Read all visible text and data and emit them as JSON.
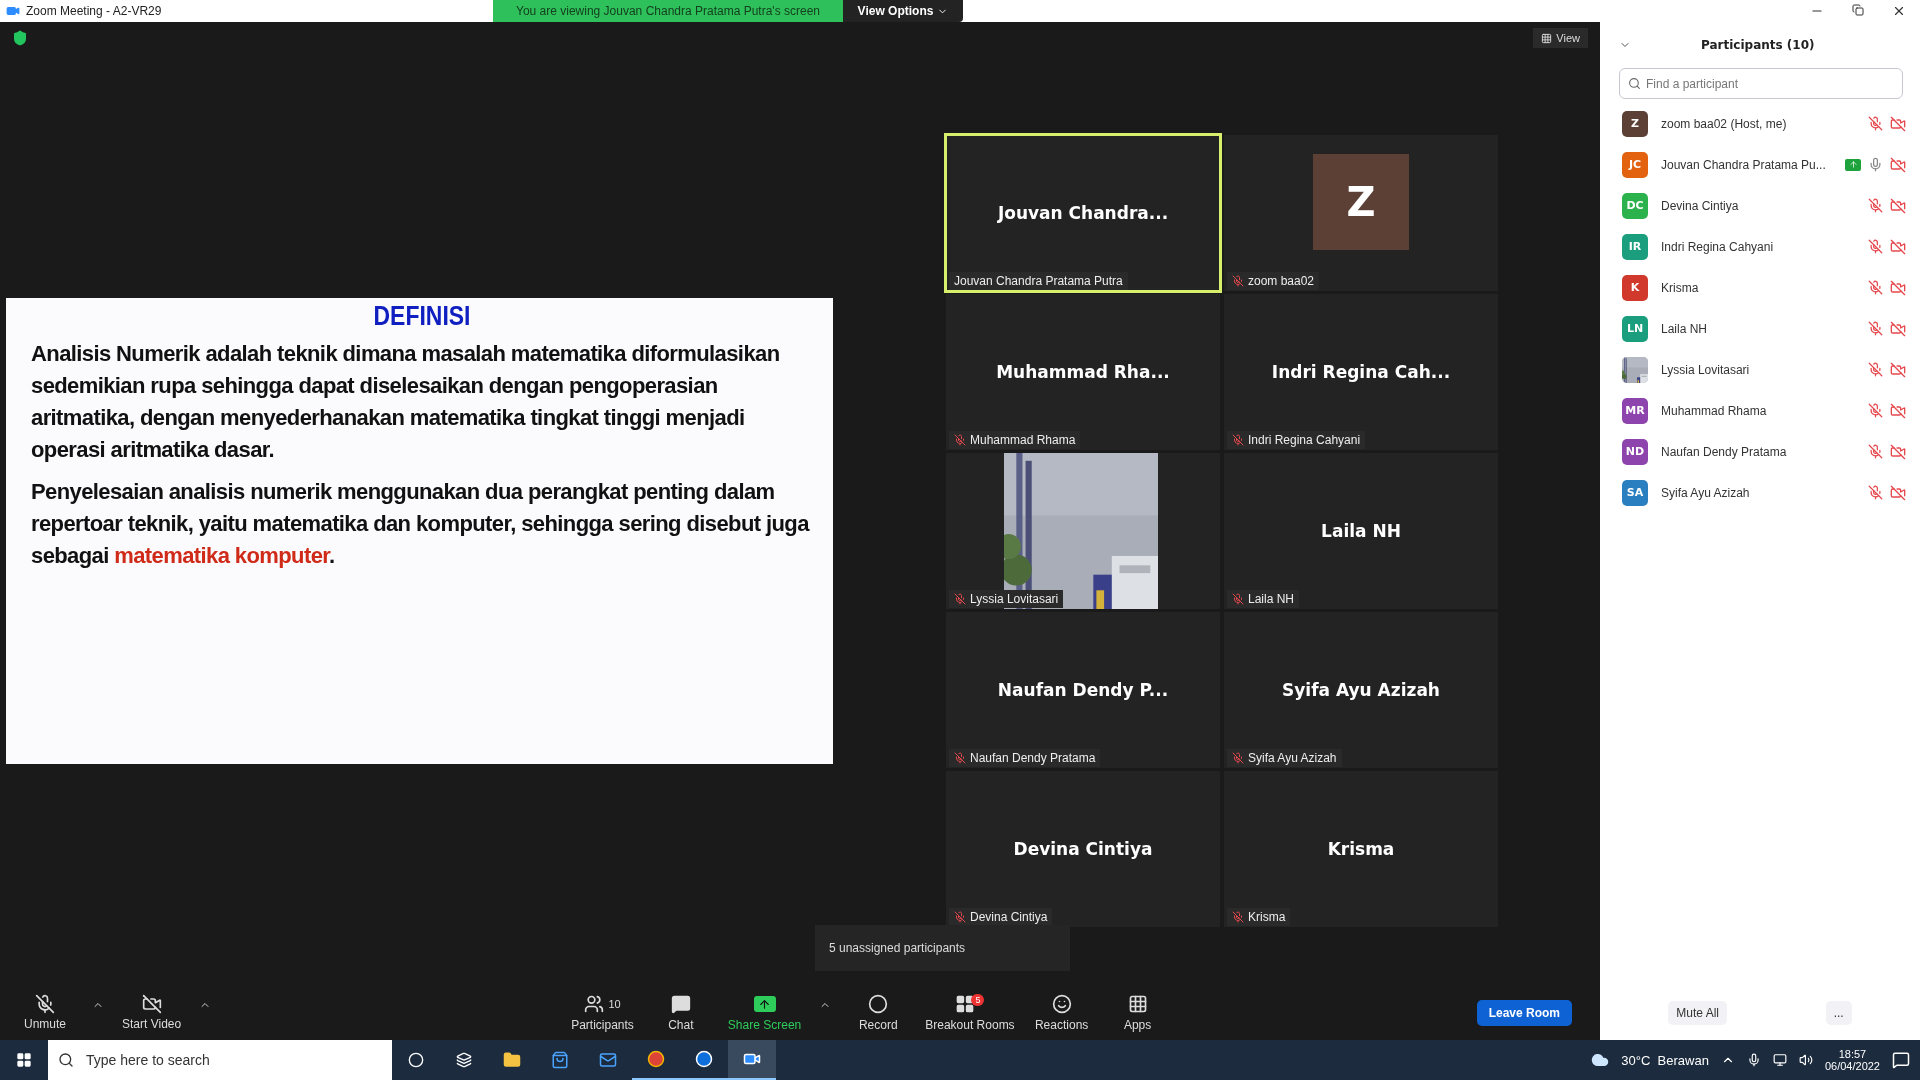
{
  "window": {
    "title": "Zoom Meeting - A2-VR29"
  },
  "share_banner": {
    "text": "You are viewing Jouvan Chandra Pratama Putra's screen",
    "button": "View Options"
  },
  "view_button": "View",
  "slide": {
    "title": "DEFINISI",
    "paragraphs": [
      {
        "text": "Analisis Numerik adalah teknik dimana masalah matematika diformulasikan sedemikian rupa sehingga dapat diselesaikan dengan pengoperasian aritmatika, dengan menyederhanakan matematika tingkat tinggi menjadi operasi aritmatika dasar."
      },
      {
        "text": "Penyelesaian analisis numerik menggunakan dua perangkat penting dalam repertoar teknik, yaitu matematika dan komputer, sehingga sering disebut juga sebagai ",
        "highlight": "matematika komputer",
        "after": "."
      }
    ]
  },
  "tiles": [
    {
      "kind": "name",
      "title": "Jouvan Chandra...",
      "label": "Jouvan Chandra Pratama Putra",
      "muted": false,
      "active": true
    },
    {
      "kind": "avatar",
      "title": "Z",
      "label": "zoom baa02",
      "muted": true,
      "active": false,
      "color": "#5c4036"
    },
    {
      "kind": "name",
      "title": "Muhammad Rha...",
      "label": "Muhammad Rhama",
      "muted": true,
      "active": false
    },
    {
      "kind": "name",
      "title": "Indri Regina Cah...",
      "label": "Indri Regina Cahyani",
      "muted": true,
      "active": false
    },
    {
      "kind": "picture",
      "label": "Lyssia Lovitasari",
      "muted": true,
      "active": false
    },
    {
      "kind": "name",
      "title": "Laila NH",
      "label": "Laila NH",
      "muted": true,
      "active": false
    },
    {
      "kind": "name",
      "title": "Naufan Dendy P...",
      "label": "Naufan Dendy Pratama",
      "muted": true,
      "active": false
    },
    {
      "kind": "name",
      "title": "Syifa Ayu Azizah",
      "label": "Syifa Ayu Azizah",
      "muted": true,
      "active": false
    },
    {
      "kind": "name",
      "title": "Devina Cintiya",
      "label": "Devina Cintiya",
      "muted": true,
      "active": false
    },
    {
      "kind": "name",
      "title": "Krisma",
      "label": "Krisma",
      "muted": true,
      "active": false
    }
  ],
  "toast": "5 unassigned participants",
  "toolbar": {
    "left": [
      {
        "kind": "mic",
        "label": "Unmute"
      },
      {
        "kind": "video",
        "label": "Start Video"
      }
    ],
    "center": [
      {
        "kind": "participants",
        "label": "Participants",
        "count": "10"
      },
      {
        "kind": "chat",
        "label": "Chat"
      },
      {
        "kind": "share",
        "label": "Share Screen"
      },
      {
        "kind": "record",
        "label": "Record"
      },
      {
        "kind": "breakout",
        "label": "Breakout Rooms",
        "badge": "5"
      },
      {
        "kind": "reactions",
        "label": "Reactions"
      },
      {
        "kind": "apps",
        "label": "Apps"
      }
    ],
    "leave": "Leave Room"
  },
  "panel": {
    "title": "Participants (10)",
    "search": {
      "placeholder": "Find a participant"
    },
    "participants": [
      {
        "initials": "Z",
        "color": "#5c4036",
        "name": "zoom baa02 (Host, me)",
        "muted": true,
        "sharing": false
      },
      {
        "initials": "JC",
        "color": "#e2620f",
        "name": "Jouvan Chandra Pratama Pu...",
        "muted": false,
        "sharing": true
      },
      {
        "initials": "DC",
        "color": "#2bb24c",
        "name": "Devina Cintiya",
        "muted": true,
        "sharing": false
      },
      {
        "initials": "IR",
        "color": "#1a9e7e",
        "name": "Indri Regina Cahyani",
        "muted": true,
        "sharing": false
      },
      {
        "initials": "K",
        "color": "#d0392b",
        "name": "Krisma",
        "muted": true,
        "sharing": false
      },
      {
        "initials": "LN",
        "color": "#1a9e7e",
        "name": "Laila NH",
        "muted": true,
        "sharing": false
      },
      {
        "kind": "picture",
        "name": "Lyssia Lovitasari",
        "muted": true,
        "sharing": false
      },
      {
        "initials": "MR",
        "color": "#8e44ad",
        "name": "Muhammad Rhama",
        "muted": true,
        "sharing": false
      },
      {
        "initials": "ND",
        "color": "#8e44ad",
        "name": "Naufan Dendy Pratama",
        "muted": true,
        "sharing": false
      },
      {
        "initials": "SA",
        "color": "#2a7fc1",
        "name": "Syifa Ayu Azizah",
        "muted": true,
        "sharing": false
      }
    ],
    "buttons": [
      "Mute All",
      "..."
    ]
  },
  "taskbar": {
    "search": {
      "placeholder": "Type here to search"
    },
    "weather": "30°C  Berawan",
    "time": "18:57",
    "date": "06/04/2022"
  }
}
